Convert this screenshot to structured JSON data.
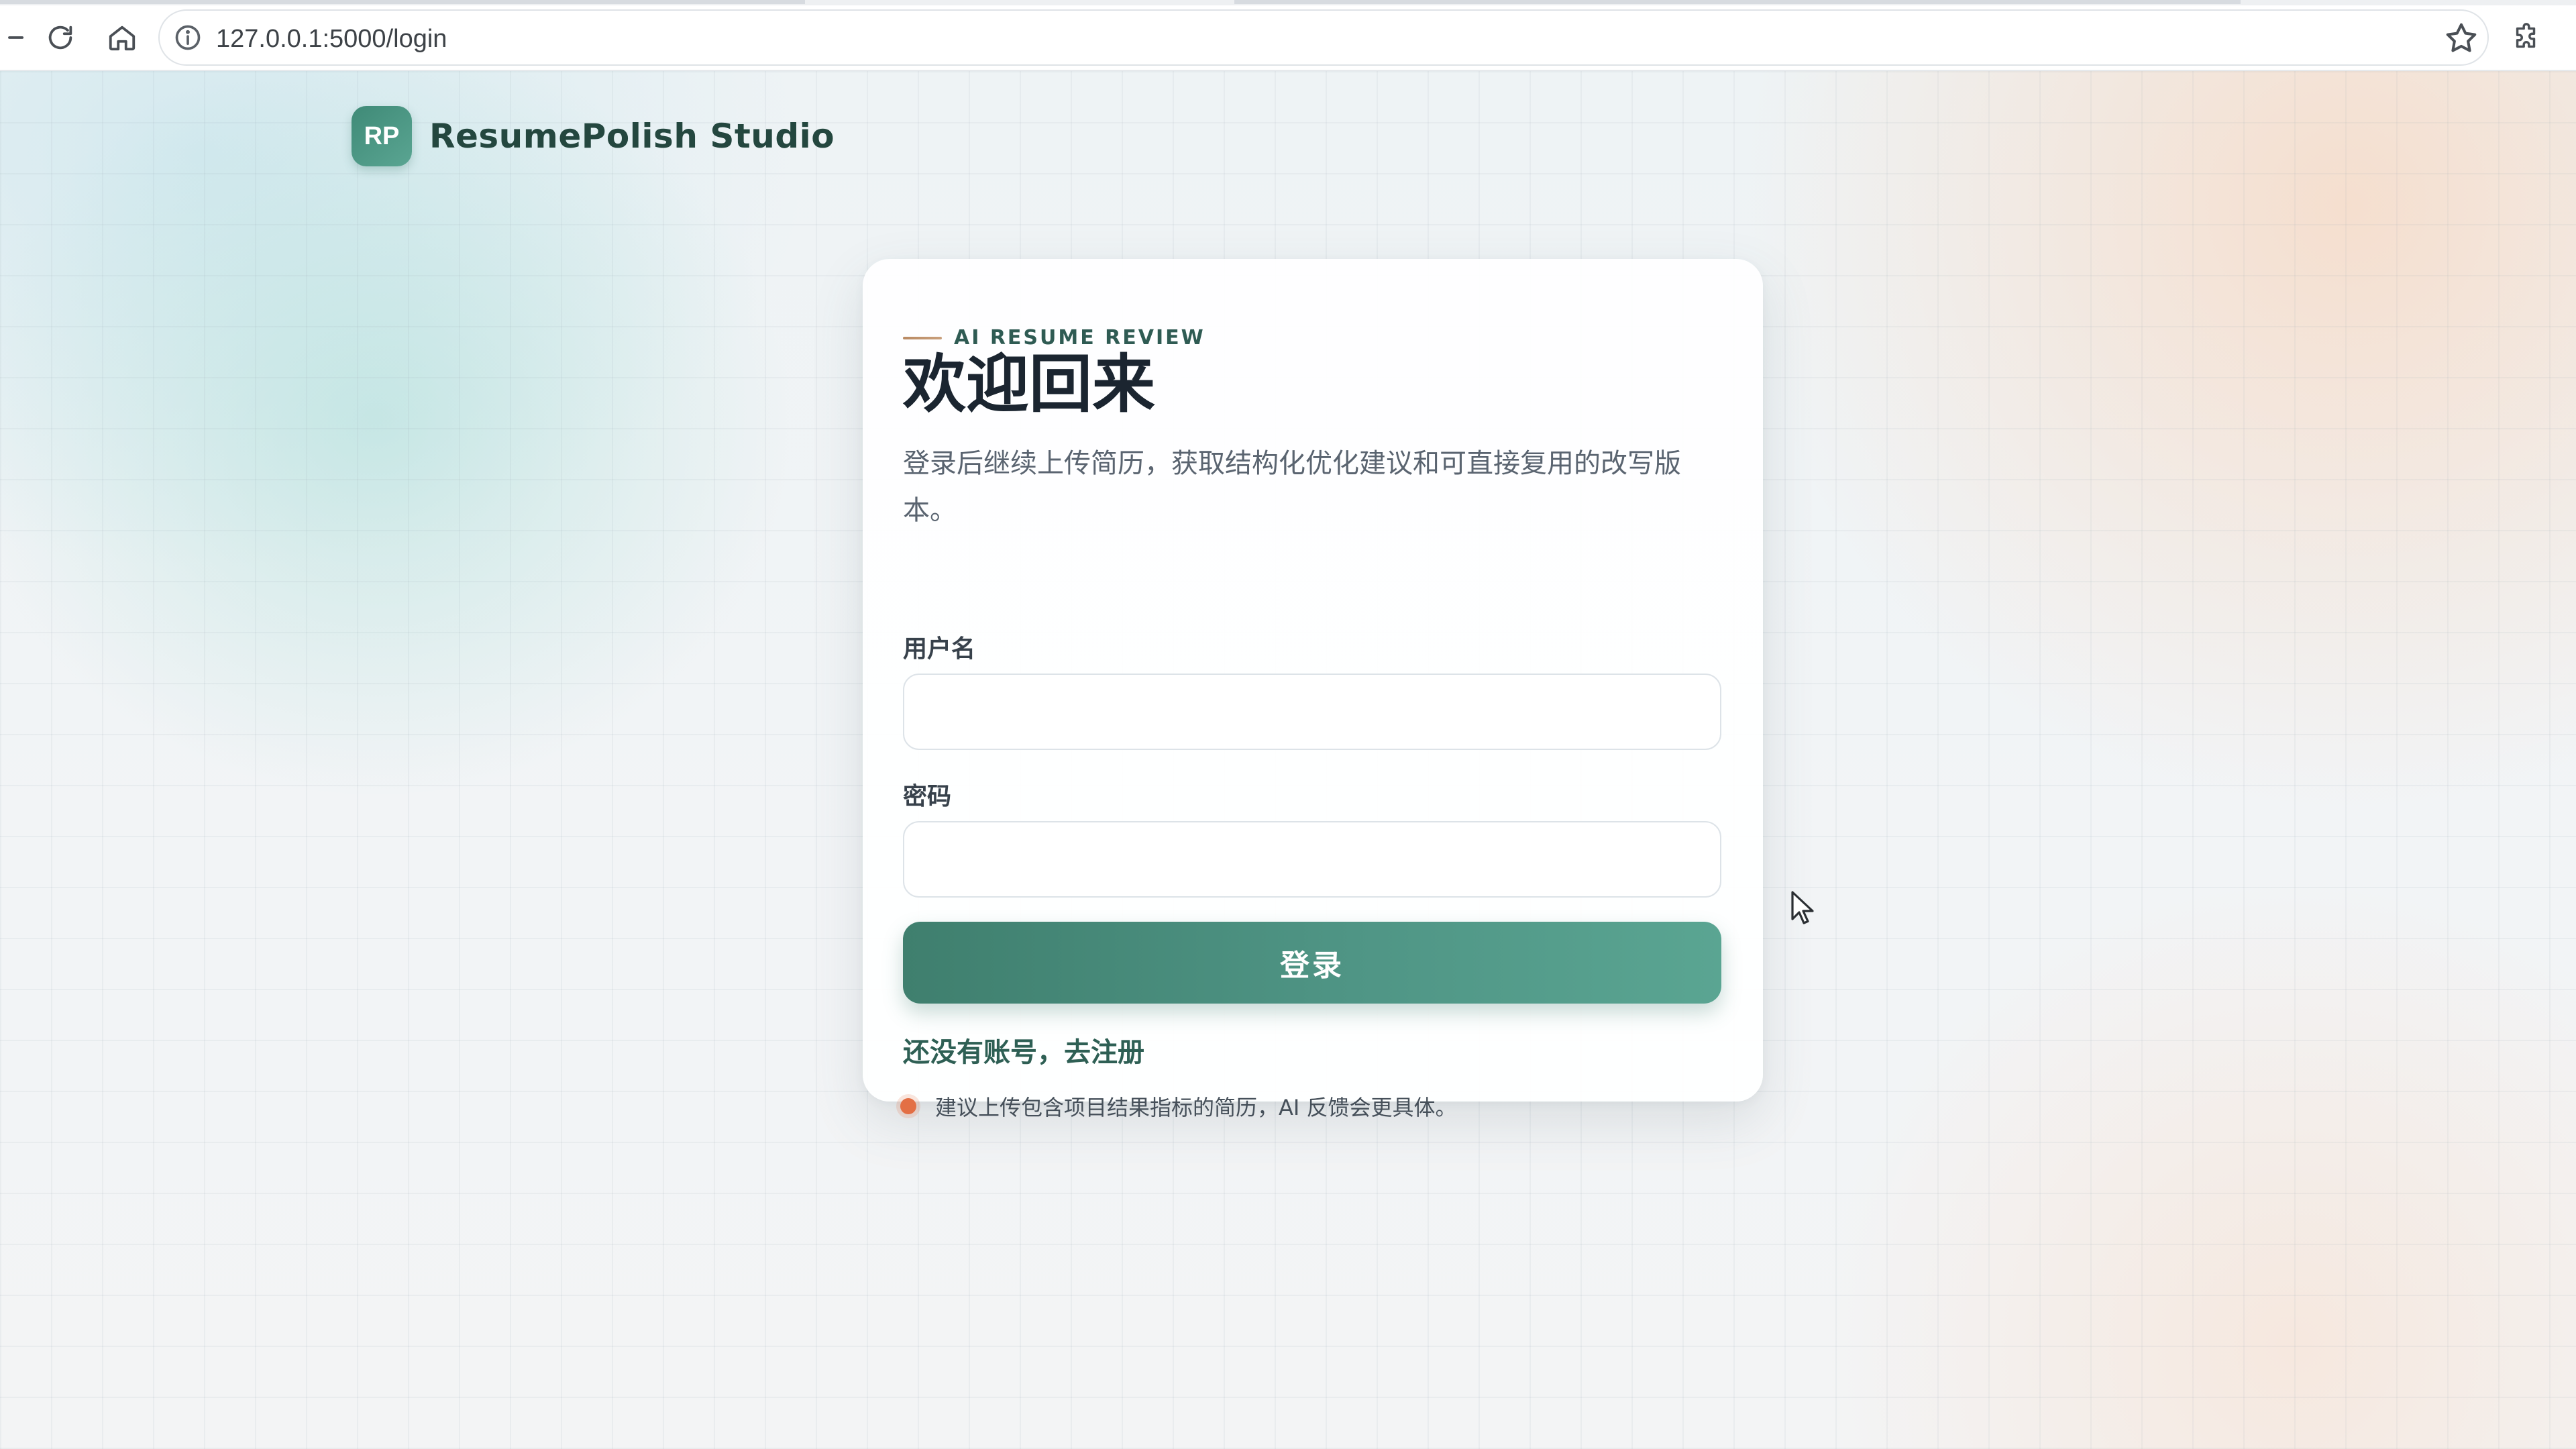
{
  "browser": {
    "url": "127.0.0.1:5000/login"
  },
  "brand": {
    "mark": "RP",
    "name": "ResumePolish Studio"
  },
  "card": {
    "eyebrow": "AI RESUME REVIEW",
    "title": "欢迎回来",
    "subtitle": "登录后继续上传简历，获取结构化优化建议和可直接复用的改写版本。",
    "username_label": "用户名",
    "username_value": "",
    "password_label": "密码",
    "password_value": "",
    "login_button": "登录",
    "register_link": "还没有账号，去注册",
    "tip": "建议上传包含项目结果指标的简历，AI 反馈会更具体。"
  },
  "colors": {
    "accent": "#4a8a7a",
    "tip_dot": "#e36f45",
    "title": "#1b2530"
  },
  "icons": [
    "back-icon",
    "reload-icon",
    "home-icon",
    "info-icon",
    "star-icon",
    "extensions-icon",
    "cursor-icon"
  ]
}
